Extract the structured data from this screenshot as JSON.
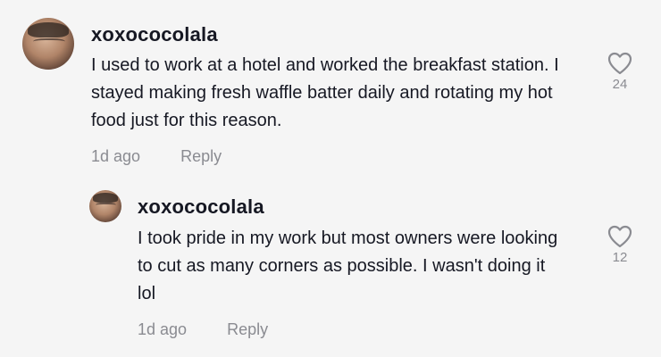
{
  "comments": [
    {
      "username": "xoxococolala",
      "text": "I used to work at a hotel and worked the breakfast station. I stayed making fresh waffle batter daily and rotating my hot food just for this reason.",
      "time": "1d ago",
      "reply_label": "Reply",
      "likes": "24",
      "icon": "heart-outline-icon"
    },
    {
      "username": "xoxococolala",
      "text": "I took pride in my work but most owners were looking to cut as many corners as possible. I wasn't doing it lol",
      "time": "1d ago",
      "reply_label": "Reply",
      "likes": "12",
      "icon": "heart-outline-icon"
    }
  ],
  "colors": {
    "background": "#f5f5f5",
    "text": "#161823",
    "secondary": "#8a8b91"
  }
}
